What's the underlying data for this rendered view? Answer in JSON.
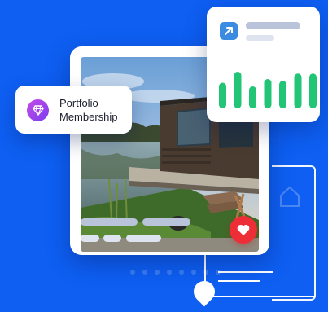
{
  "badge": {
    "title_line1": "Portfolio",
    "title_line2": "Membership",
    "icon": "diamond-icon"
  },
  "stats": {
    "icon": "arrow-up-right-icon",
    "bar_heights": [
      0.7,
      1.0,
      0.6,
      0.8,
      0.75,
      0.95,
      0.95
    ]
  },
  "post": {
    "image": "tiny-house-by-lake-photo",
    "like_icon": "heart-icon"
  },
  "colors": {
    "background": "#0e5ff2",
    "chart_green": "#22c476",
    "heart_red": "#ee2e36",
    "badge_gradient_start": "#c54be8",
    "badge_gradient_end": "#7a3df0",
    "arrow_blue": "#3b8be0"
  }
}
